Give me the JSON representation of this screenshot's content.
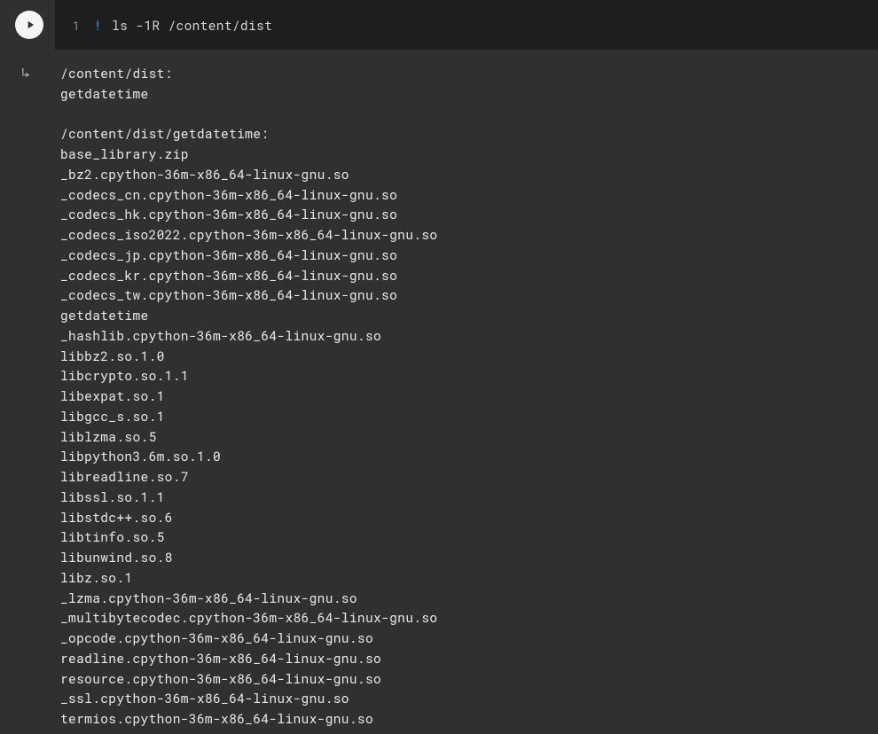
{
  "cell": {
    "lineNumber": "1",
    "bang": "!",
    "command": " ls -1R /content/dist"
  },
  "output": {
    "lines": [
      "/content/dist:",
      "getdatetime",
      "",
      "/content/dist/getdatetime:",
      "base_library.zip",
      "_bz2.cpython-36m-x86_64-linux-gnu.so",
      "_codecs_cn.cpython-36m-x86_64-linux-gnu.so",
      "_codecs_hk.cpython-36m-x86_64-linux-gnu.so",
      "_codecs_iso2022.cpython-36m-x86_64-linux-gnu.so",
      "_codecs_jp.cpython-36m-x86_64-linux-gnu.so",
      "_codecs_kr.cpython-36m-x86_64-linux-gnu.so",
      "_codecs_tw.cpython-36m-x86_64-linux-gnu.so",
      "getdatetime",
      "_hashlib.cpython-36m-x86_64-linux-gnu.so",
      "libbz2.so.1.0",
      "libcrypto.so.1.1",
      "libexpat.so.1",
      "libgcc_s.so.1",
      "liblzma.so.5",
      "libpython3.6m.so.1.0",
      "libreadline.so.7",
      "libssl.so.1.1",
      "libstdc++.so.6",
      "libtinfo.so.5",
      "libunwind.so.8",
      "libz.so.1",
      "_lzma.cpython-36m-x86_64-linux-gnu.so",
      "_multibytecodec.cpython-36m-x86_64-linux-gnu.so",
      "_opcode.cpython-36m-x86_64-linux-gnu.so",
      "readline.cpython-36m-x86_64-linux-gnu.so",
      "resource.cpython-36m-x86_64-linux-gnu.so",
      "_ssl.cpython-36m-x86_64-linux-gnu.so",
      "termios.cpython-36m-x86_64-linux-gnu.so"
    ]
  }
}
